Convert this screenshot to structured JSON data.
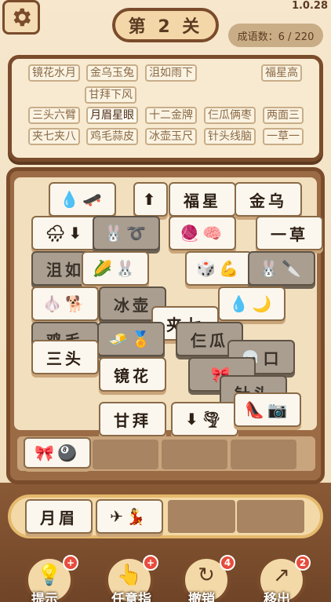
{
  "version": "1.0.28",
  "level": {
    "title": "第 2 关"
  },
  "counter": {
    "label": "成语数：6 / 220"
  },
  "colors": {
    "frame": "#7a4c2c",
    "tile": "#fbf7ef",
    "dim_tile": "#a99e90",
    "badge": "#e74c3c"
  },
  "idioms": [
    {
      "text": "镜花水月"
    },
    {
      "text": "金乌玉兔"
    },
    {
      "text": "沮如雨下"
    },
    {
      "text": "福星高"
    },
    {
      "text": "甘拜下风"
    },
    {
      "text": "三头六臂"
    },
    {
      "pre": "月眉",
      "post": "星眼"
    },
    {
      "text": "十二金牌"
    },
    {
      "text": "仨瓜俩枣"
    },
    {
      "text": "两面三"
    },
    {
      "text": "夹七夹八"
    },
    {
      "text": "鸡毛蒜皮"
    },
    {
      "text": "冰壶玉尺"
    },
    {
      "text": "针头线脑"
    },
    {
      "text": "一草一"
    }
  ],
  "board_tiles": [
    {
      "text": "💧🛹",
      "dim": false
    },
    {
      "text": "⬆",
      "dim": false
    },
    {
      "text": "福星",
      "dim": false
    },
    {
      "text": "金乌",
      "dim": false
    },
    {
      "text": "🌧⬇",
      "dim": false
    },
    {
      "text": "🐰➰",
      "dim": true
    },
    {
      "text": "🧶🧠",
      "dim": false
    },
    {
      "text": "一草",
      "dim": false
    },
    {
      "text": "沮如",
      "dim": true
    },
    {
      "text": "🌽🐰",
      "dim": false
    },
    {
      "text": "🎲💪",
      "dim": false
    },
    {
      "text": "🐰🔪",
      "dim": true
    },
    {
      "text": "🧄🐕",
      "dim": false
    },
    {
      "text": "冰壶",
      "dim": true
    },
    {
      "text": "💧🌙",
      "dim": false
    },
    {
      "text": "夹七",
      "dim": false
    },
    {
      "text": "鸡毛",
      "dim": true
    },
    {
      "text": "🧈🏅",
      "dim": true
    },
    {
      "text": "仨瓜",
      "dim": true
    },
    {
      "text": "三头",
      "dim": false
    },
    {
      "text": "💀口",
      "dim": true
    },
    {
      "text": "镜花",
      "dim": false
    },
    {
      "text": "🎀",
      "dim": true
    },
    {
      "text": "针头",
      "dim": true
    },
    {
      "text": "甘拜",
      "dim": false
    },
    {
      "text": "⬇🌪",
      "dim": false
    },
    {
      "text": "👠📷",
      "dim": false
    }
  ],
  "tray": [
    {
      "text": "🎀🎱"
    }
  ],
  "answer": [
    {
      "text": "月眉"
    },
    {
      "text": "✈💃"
    }
  ],
  "tools": [
    {
      "label": "提示",
      "badge": "+",
      "icon": "bulb-icon"
    },
    {
      "label": "任意指",
      "badge": "+",
      "icon": "pointer-icon"
    },
    {
      "label": "撤销",
      "badge": "4",
      "icon": "undo-icon"
    },
    {
      "label": "移出",
      "badge": "2",
      "icon": "remove-icon"
    }
  ]
}
